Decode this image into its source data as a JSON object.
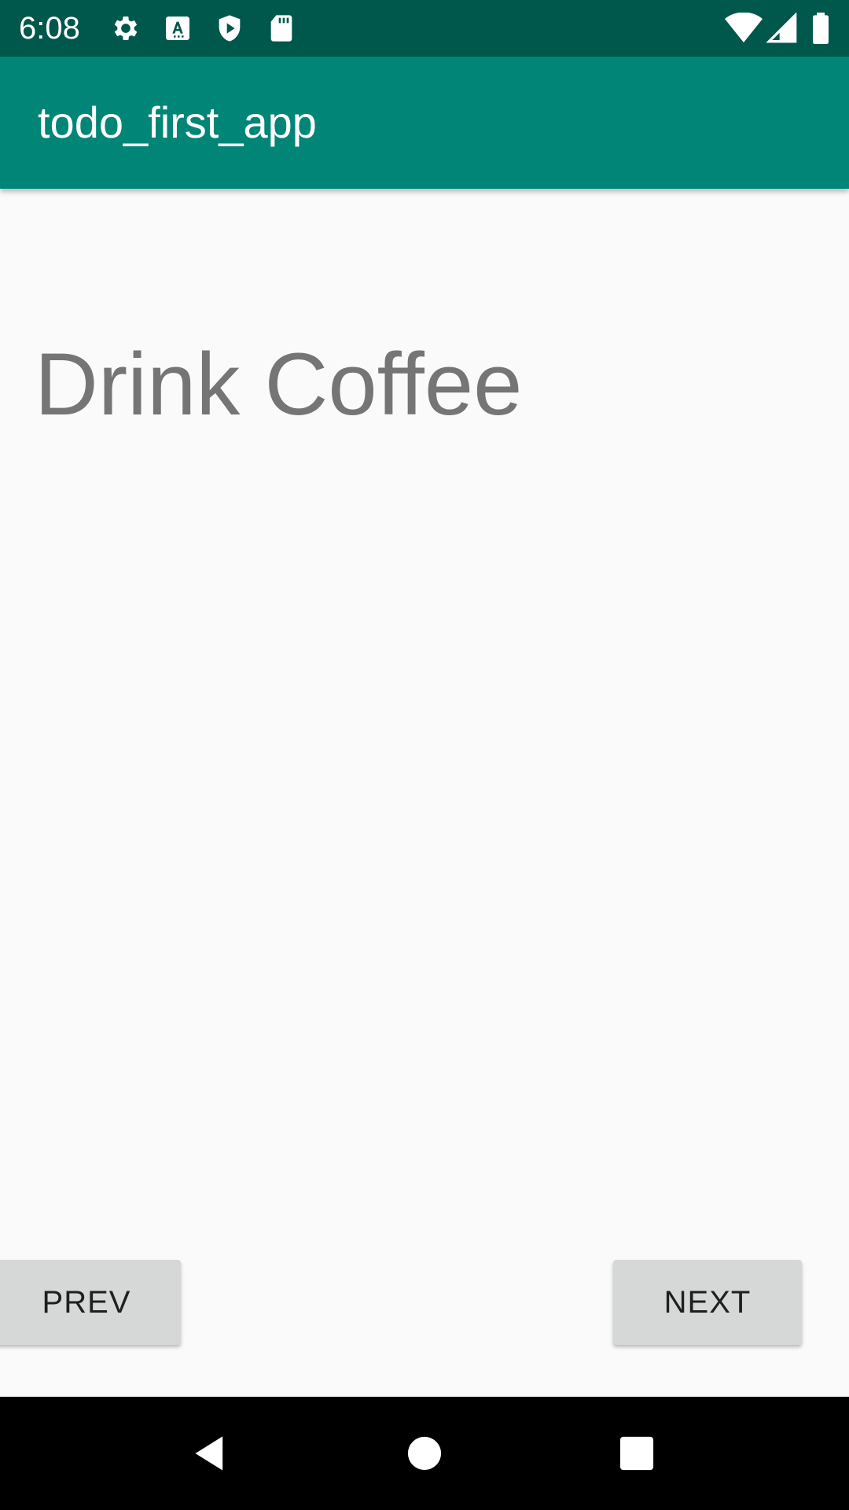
{
  "status_bar": {
    "time": "6:08",
    "left_icons": [
      "gear-icon",
      "font-a-icon",
      "play-shield-icon",
      "sd-card-icon"
    ],
    "right_icons": [
      "wifi-icon",
      "signal-icon",
      "battery-icon"
    ]
  },
  "app_bar": {
    "title": "todo_first_app",
    "color": "#008577"
  },
  "content": {
    "todo_text": "Drink Coffee"
  },
  "buttons": {
    "prev_label": "PREV",
    "next_label": "NEXT"
  },
  "nav_bar": {
    "icons": [
      "back-icon",
      "home-icon",
      "recents-icon"
    ]
  },
  "colors": {
    "status_bar": "#00574b",
    "app_bar": "#008577",
    "background": "#fafafa",
    "button": "#d6d7d7"
  }
}
